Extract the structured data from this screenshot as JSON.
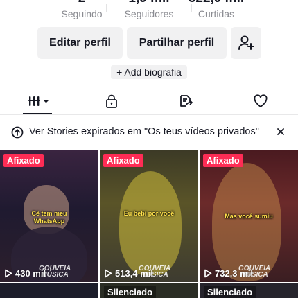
{
  "stats": [
    {
      "value": "2",
      "label": "Seguindo"
    },
    {
      "value": "1,9 mil",
      "label": "Seguidores"
    },
    {
      "value": "322,9 mil",
      "label": "Curtidas"
    }
  ],
  "actions": {
    "edit_label": "Editar perfil",
    "share_label": "Partilhar perfil",
    "add_friend_icon": "add-user-icon"
  },
  "bio_label": "+ Add biografia",
  "tabs": [
    {
      "name": "videos",
      "icon": "grid-icon",
      "active": true
    },
    {
      "name": "private",
      "icon": "lock-icon",
      "active": false
    },
    {
      "name": "reposts",
      "icon": "repost-icon",
      "active": false
    },
    {
      "name": "likes",
      "icon": "heart-icon",
      "active": false
    }
  ],
  "banner": {
    "text": "Ver Stories expirados em \"Os teus vídeos privados\"",
    "icon": "upload-icon",
    "close_icon": "close-icon"
  },
  "videos": [
    {
      "badge": "Afixado",
      "caption": "Cê tem meu WhatsApp",
      "views": "430 mil",
      "watermark": "GOUVEIA MÚSICA"
    },
    {
      "badge": "Afixado",
      "caption": "Eu bebi por você",
      "views": "513,4 mil",
      "watermark": "GOUVEIA MÚSICA"
    },
    {
      "badge": "Afixado",
      "caption": "Mas você sumiu",
      "views": "732,3 mil",
      "watermark": "GOUVEIA MÚSICA"
    },
    {
      "badge": "",
      "caption": "",
      "views": "",
      "watermark": ""
    },
    {
      "badge": "Silenciado",
      "caption": "",
      "views": "",
      "watermark": ""
    },
    {
      "badge": "Silenciado",
      "caption": "",
      "views": "",
      "watermark": ""
    }
  ],
  "colors": {
    "accent": "#fe2c55",
    "text": "#161823",
    "secondary_text": "#8a8b91",
    "button_bg": "#f1f1f2"
  }
}
